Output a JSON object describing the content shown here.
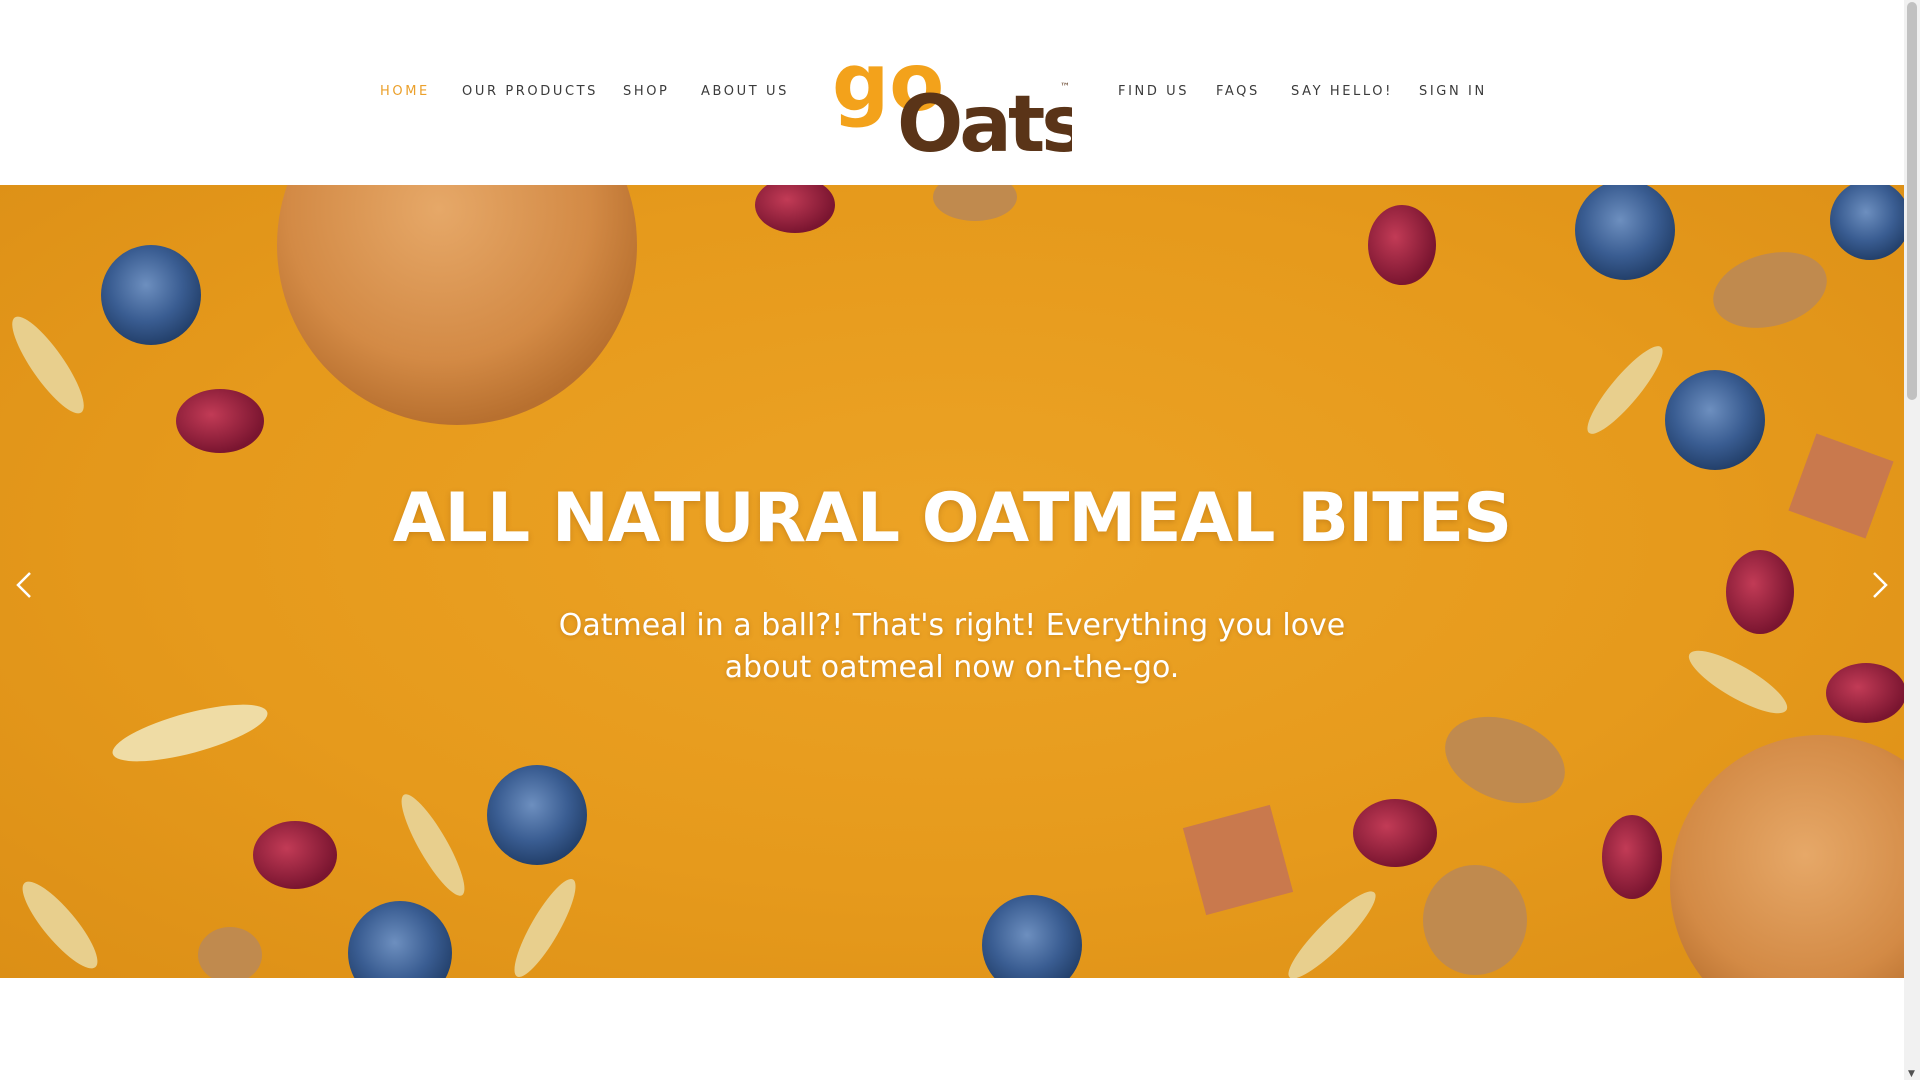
{
  "nav": {
    "left": [
      {
        "label": "HOME",
        "active": true
      },
      {
        "label": "OUR PRODUCTS"
      },
      {
        "label": "SHOP"
      },
      {
        "label": "ABOUT US"
      }
    ],
    "right": [
      {
        "label": "FIND US"
      },
      {
        "label": "FAQS"
      },
      {
        "label": "SAY HELLO!"
      },
      {
        "label": "SIGN IN"
      }
    ]
  },
  "logo": {
    "text_go": "go",
    "text_oats": "Oats",
    "tm": "™",
    "colors": {
      "go": "#f3a21b",
      "oats": "#5a3418"
    }
  },
  "hero": {
    "title": "ALL NATURAL OATMEAL BITES",
    "subtitle": "Oatmeal in a ball?! That's right! Everything you love about oatmeal now on-the-go.",
    "prev_icon": "chevron-left-icon",
    "next_icon": "chevron-right-icon",
    "background": "#e89a1f"
  },
  "colors": {
    "accent": "#eba02b",
    "nav_text": "#3b3b3b"
  }
}
